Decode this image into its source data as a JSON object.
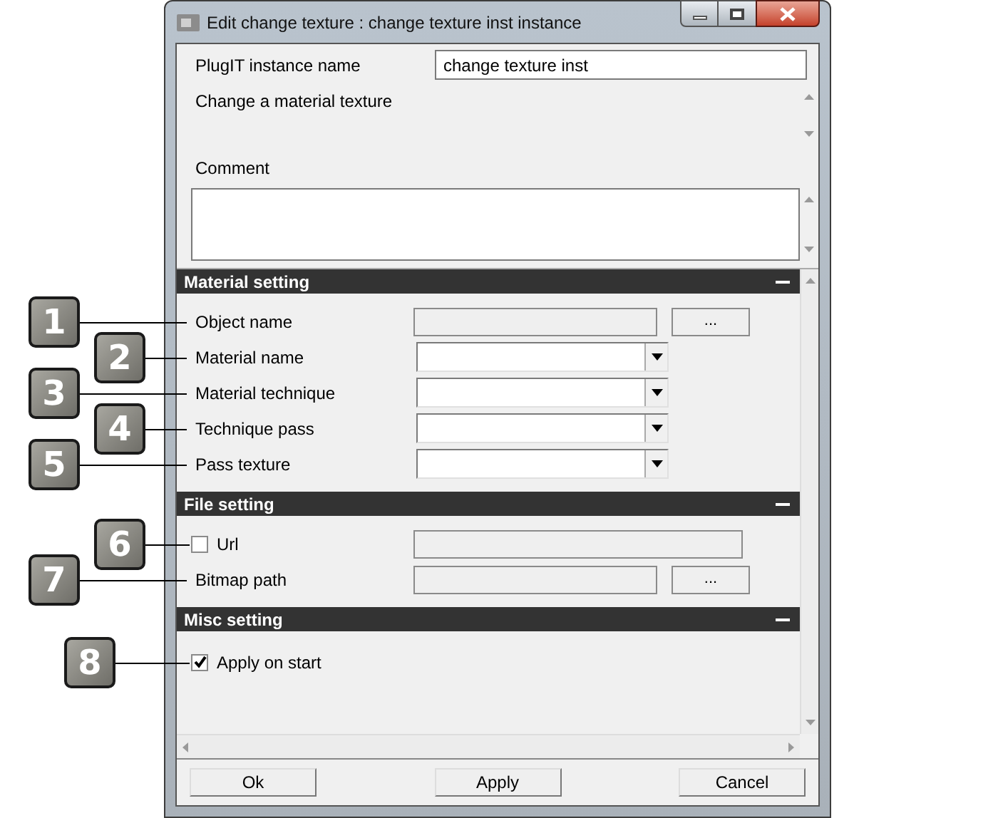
{
  "window": {
    "title": "Edit change texture : change texture inst instance"
  },
  "instance_name": {
    "label": "PlugIT instance name",
    "value": "change texture inst"
  },
  "description": "Change a material texture",
  "comment": {
    "label": "Comment"
  },
  "sections": [
    {
      "title": "Material setting",
      "rows": [
        {
          "kind": "browse",
          "label": "Object name",
          "callout": "1",
          "button": "..."
        },
        {
          "kind": "combo",
          "label": "Material name",
          "callout": "2"
        },
        {
          "kind": "combo",
          "label": "Material technique",
          "callout": "3"
        },
        {
          "kind": "combo",
          "label": "Technique pass",
          "callout": "4"
        },
        {
          "kind": "combo",
          "label": "Pass texture",
          "callout": "5"
        }
      ]
    },
    {
      "title": "File setting",
      "rows": [
        {
          "kind": "check_field",
          "label": "Url",
          "callout": "6",
          "checked": false
        },
        {
          "kind": "browse",
          "label": "Bitmap path",
          "callout": "7",
          "button": "..."
        }
      ]
    },
    {
      "title": "Misc setting",
      "rows": [
        {
          "kind": "check",
          "label": "Apply on start",
          "callout": "8",
          "checked": true
        }
      ]
    }
  ],
  "buttons": [
    "Ok",
    "Apply",
    "Cancel"
  ]
}
